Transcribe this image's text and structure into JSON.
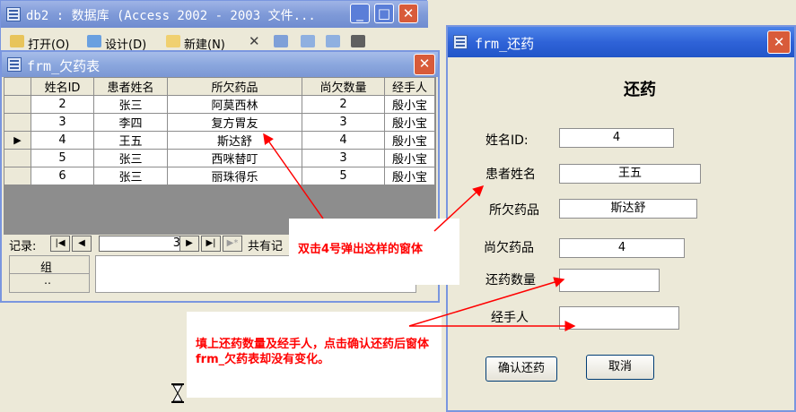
{
  "db_window": {
    "title": "db2 : 数据库 (Access 2002 - 2003 文件...",
    "toolbar": {
      "open": "打开(O)",
      "design": "设计(D)",
      "new": "新建(N)"
    }
  },
  "debt_form": {
    "title": "frm_欠药表",
    "columns": [
      "姓名ID",
      "患者姓名",
      "所欠药品",
      "尚欠数量",
      "经手人"
    ],
    "rows": [
      {
        "id": "2",
        "name": "张三",
        "drug": "阿莫西林",
        "qty": "2",
        "handler": "殷小宝"
      },
      {
        "id": "3",
        "name": "李四",
        "drug": "复方胃友",
        "qty": "3",
        "handler": "殷小宝"
      },
      {
        "id": "4",
        "name": "王五",
        "drug": "斯达舒",
        "qty": "4",
        "handler": "殷小宝"
      },
      {
        "id": "5",
        "name": "张三",
        "drug": "西咪替叮",
        "qty": "3",
        "handler": "殷小宝"
      },
      {
        "id": "6",
        "name": "张三",
        "drug": "丽珠得乐",
        "qty": "5",
        "handler": "殷小宝"
      }
    ],
    "current_row_marker": "▶",
    "nav": {
      "label": "记录:",
      "current": "3",
      "total_prefix": "共有记"
    },
    "group_label": "组",
    "group_dots": "‥"
  },
  "return_form": {
    "title": "frm_还药",
    "heading": "还药",
    "labels": {
      "patient_id": "姓名ID:",
      "patient_name": "患者姓名",
      "owed_drug": "所欠药品",
      "owed_qty": "尚欠药品",
      "return_qty": "还药数量",
      "handler": "经手人"
    },
    "values": {
      "patient_id": "4",
      "patient_name": "王五",
      "owed_drug": "斯达舒",
      "owed_qty": "4",
      "return_qty": "",
      "handler": ""
    },
    "buttons": {
      "confirm": "确认还药",
      "cancel": "取消"
    }
  },
  "annotations": {
    "double_click": "双击4号弹出这样的窗体",
    "problem": "填上还药数量及经手人，点击确认还药后窗体frm_欠药表却没有变化。"
  },
  "colors": {
    "annotation_red": "#ff0000",
    "xp_blue": "#2f63d8"
  }
}
